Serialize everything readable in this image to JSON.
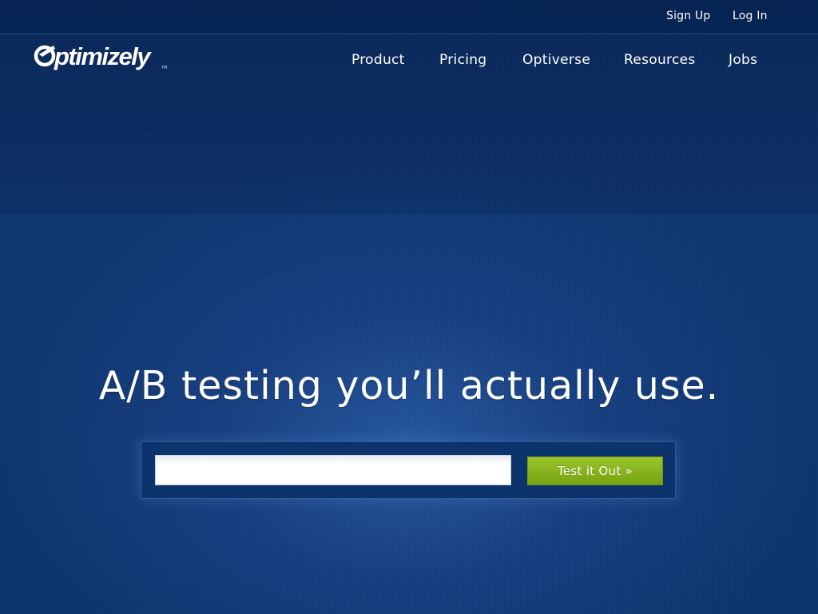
{
  "header": {
    "logo_text": "ptimizely",
    "logo_tm": "TM",
    "utility_links": {
      "sign_up": "Sign Up",
      "log_in": "Log In"
    },
    "nav": {
      "product": "Product",
      "pricing": "Pricing",
      "optiverse": "Optiverse",
      "resources": "Resources",
      "jobs": "Jobs"
    }
  },
  "hero": {
    "headline": "A/B testing you’ll actually use.",
    "url_input": {
      "value": "",
      "placeholder": ""
    },
    "cta_label": "Test it Out »"
  },
  "colors": {
    "background": "#0d336b",
    "cta_green": "#86b21c",
    "text": "#ffffff"
  }
}
